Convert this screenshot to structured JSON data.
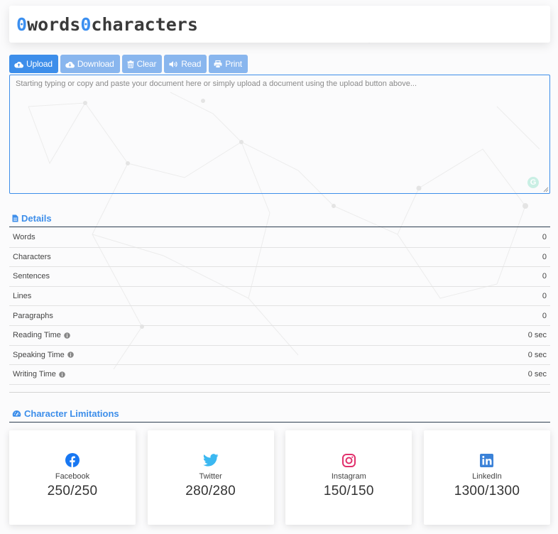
{
  "counter": {
    "words_count": "0",
    "words_label": "words",
    "characters_count": "0",
    "characters_label": "characters"
  },
  "toolbar": {
    "upload": "Upload",
    "download": "Download",
    "clear": "Clear",
    "read": "Read",
    "print": "Print"
  },
  "editor": {
    "value": "",
    "placeholder": "Starting typing or copy and paste your document here or simply upload a document using the upload button above..."
  },
  "details": {
    "title": "Details",
    "rows": [
      {
        "label": "Words",
        "value": "0",
        "info": false
      },
      {
        "label": "Characters",
        "value": "0",
        "info": false
      },
      {
        "label": "Sentences",
        "value": "0",
        "info": false
      },
      {
        "label": "Lines",
        "value": "0",
        "info": false
      },
      {
        "label": "Paragraphs",
        "value": "0",
        "info": false
      },
      {
        "label": "Reading Time",
        "value": "0 sec",
        "info": true
      },
      {
        "label": "Speaking Time",
        "value": "0 sec",
        "info": true
      },
      {
        "label": "Writing Time",
        "value": "0 sec",
        "info": true
      }
    ]
  },
  "limits": {
    "title": "Character Limitations",
    "cards": [
      {
        "name": "Facebook",
        "value": "250/250",
        "icon": "facebook-icon",
        "color": "#1877f2"
      },
      {
        "name": "Twitter",
        "value": "280/280",
        "icon": "twitter-icon",
        "color": "#3bb8f1"
      },
      {
        "name": "Instagram",
        "value": "150/150",
        "icon": "instagram-icon",
        "color": "#e1306c"
      },
      {
        "name": "LinkedIn",
        "value": "1300/1300",
        "icon": "linkedin-icon",
        "color": "#3b82d8"
      }
    ]
  },
  "colors": {
    "accent": "#3d8eea",
    "accent_light": "#89b6ee",
    "heading_rule": "#2d3e50"
  }
}
